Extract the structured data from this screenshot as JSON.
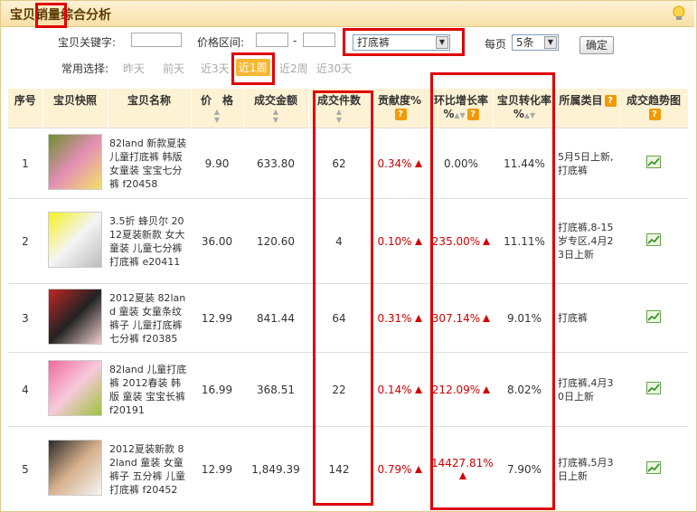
{
  "title": "宝贝销量综合分析",
  "filters": {
    "keyword_label": "宝贝关键字:",
    "price_label": "价格区间:",
    "price_sep": "-",
    "category_value": "打底裤",
    "per_page_label": "每页",
    "per_page_value": "5条",
    "confirm_label": "确定",
    "quick_label": "常用选择:",
    "quick_options": [
      "昨天",
      "前天",
      "近3天",
      "近1周",
      "近2周",
      "近30天"
    ],
    "quick_active": "近1周"
  },
  "table": {
    "headers": {
      "index": "序号",
      "snapshot": "宝贝快照",
      "name": "宝贝名称",
      "price": "价　格",
      "amount": "成交金额",
      "count": "成交件数",
      "contrib": "贡献度%",
      "mom_1": "环比增长率",
      "mom_2": "%",
      "conv_1": "宝贝转化率",
      "conv_2": "%",
      "category": "所属类目",
      "trend": "成交趋势图"
    },
    "rows": [
      {
        "idx": "1",
        "name": "82land 新款夏装儿童打底裤 韩版女童装 宝宝七分裤 f20458",
        "price": "9.90",
        "amount": "633.80",
        "count": "62",
        "contrib": "0.34%",
        "mom": "0.00%",
        "conv": "11.44%",
        "category": "5月5日上新,打底裤"
      },
      {
        "idx": "2",
        "name": "3.5折 蜂贝尔 2012夏装新款 女大童装 儿童七分裤 打底裤 e20411",
        "price": "36.00",
        "amount": "120.60",
        "count": "4",
        "contrib": "0.10%",
        "mom": "235.00%",
        "conv": "11.11%",
        "category": "打底裤,8-15岁专区,4月23日上新"
      },
      {
        "idx": "3",
        "name": "2012夏装 82land 童装 女童条纹裤子 儿童打底裤七分裤 f20385",
        "price": "12.99",
        "amount": "841.44",
        "count": "64",
        "contrib": "0.31%",
        "mom": "307.14%",
        "conv": "9.01%",
        "category": "打底裤"
      },
      {
        "idx": "4",
        "name": "82land 儿童打底裤 2012春装 韩版 童装 宝宝长裤 f20191",
        "price": "16.99",
        "amount": "368.51",
        "count": "22",
        "contrib": "0.14%",
        "mom": "212.09%",
        "conv": "8.02%",
        "category": "打底裤,4月30日上新"
      },
      {
        "idx": "5",
        "name": "2012夏装新款 82land 童装 女童裤子 五分裤 儿童打底裤 f20452",
        "price": "12.99",
        "amount": "1,849.39",
        "count": "142",
        "contrib": "0.79%",
        "mom": "14427.81%",
        "conv": "7.90%",
        "category": "打底裤,5月3日上新"
      }
    ]
  },
  "colors": {
    "highlight": "#e00000",
    "header_bg": "#fdf2d4",
    "accent": "#f7b733",
    "up": "#d10000"
  }
}
